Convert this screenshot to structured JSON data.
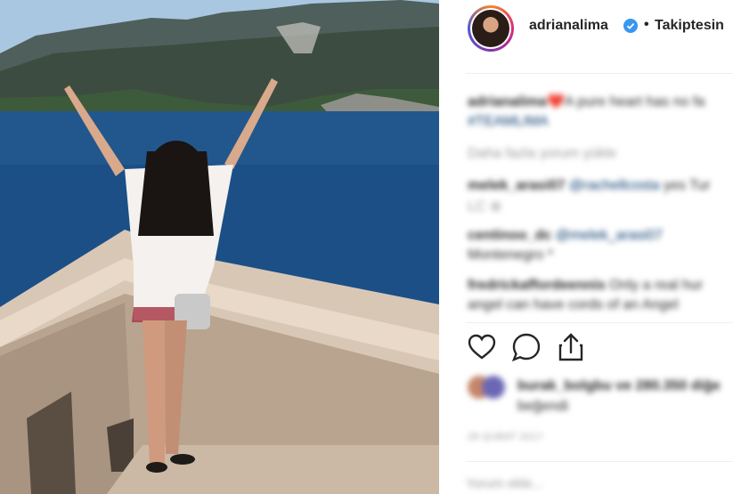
{
  "post": {
    "username": "adrianalima",
    "follow_separator": "•",
    "follow_label": "Takiptesin",
    "caption_user": "adrianalima",
    "caption_text": "❤️A pure heart has no fa",
    "caption_hashtag": "#TEAMLIMA",
    "load_more": "Daha fazla yorum yükle",
    "comments": [
      {
        "user": "melek_arasi07",
        "mention": "@rachellcosta",
        "text": " yes Tur",
        "subline": " "
      },
      {
        "user": "centinoo_dc",
        "mention": "@melek_arasi07",
        "text": "",
        "subline": "Montenegro *"
      },
      {
        "user": "fredrickaffordeennis",
        "mention": "",
        "text": " Only a real hur",
        "subline": "angel can have cords of an Angel"
      }
    ],
    "likes_text": "burak_bolgbu ve 280.350 diğe",
    "likes_text_line2": "beğendi",
    "date": "28 ŞUBAT 2017",
    "add_comment_placeholder": "Yorum ekle..."
  },
  "icons": {
    "verified": "verified-badge-icon",
    "like": "heart-icon",
    "comment": "comment-bubble-icon",
    "share": "share-upload-icon"
  },
  "colors": {
    "verified_blue": "#3897f0",
    "text_dark": "#262626",
    "muted": "#999999",
    "mention_blue": "#003569"
  }
}
